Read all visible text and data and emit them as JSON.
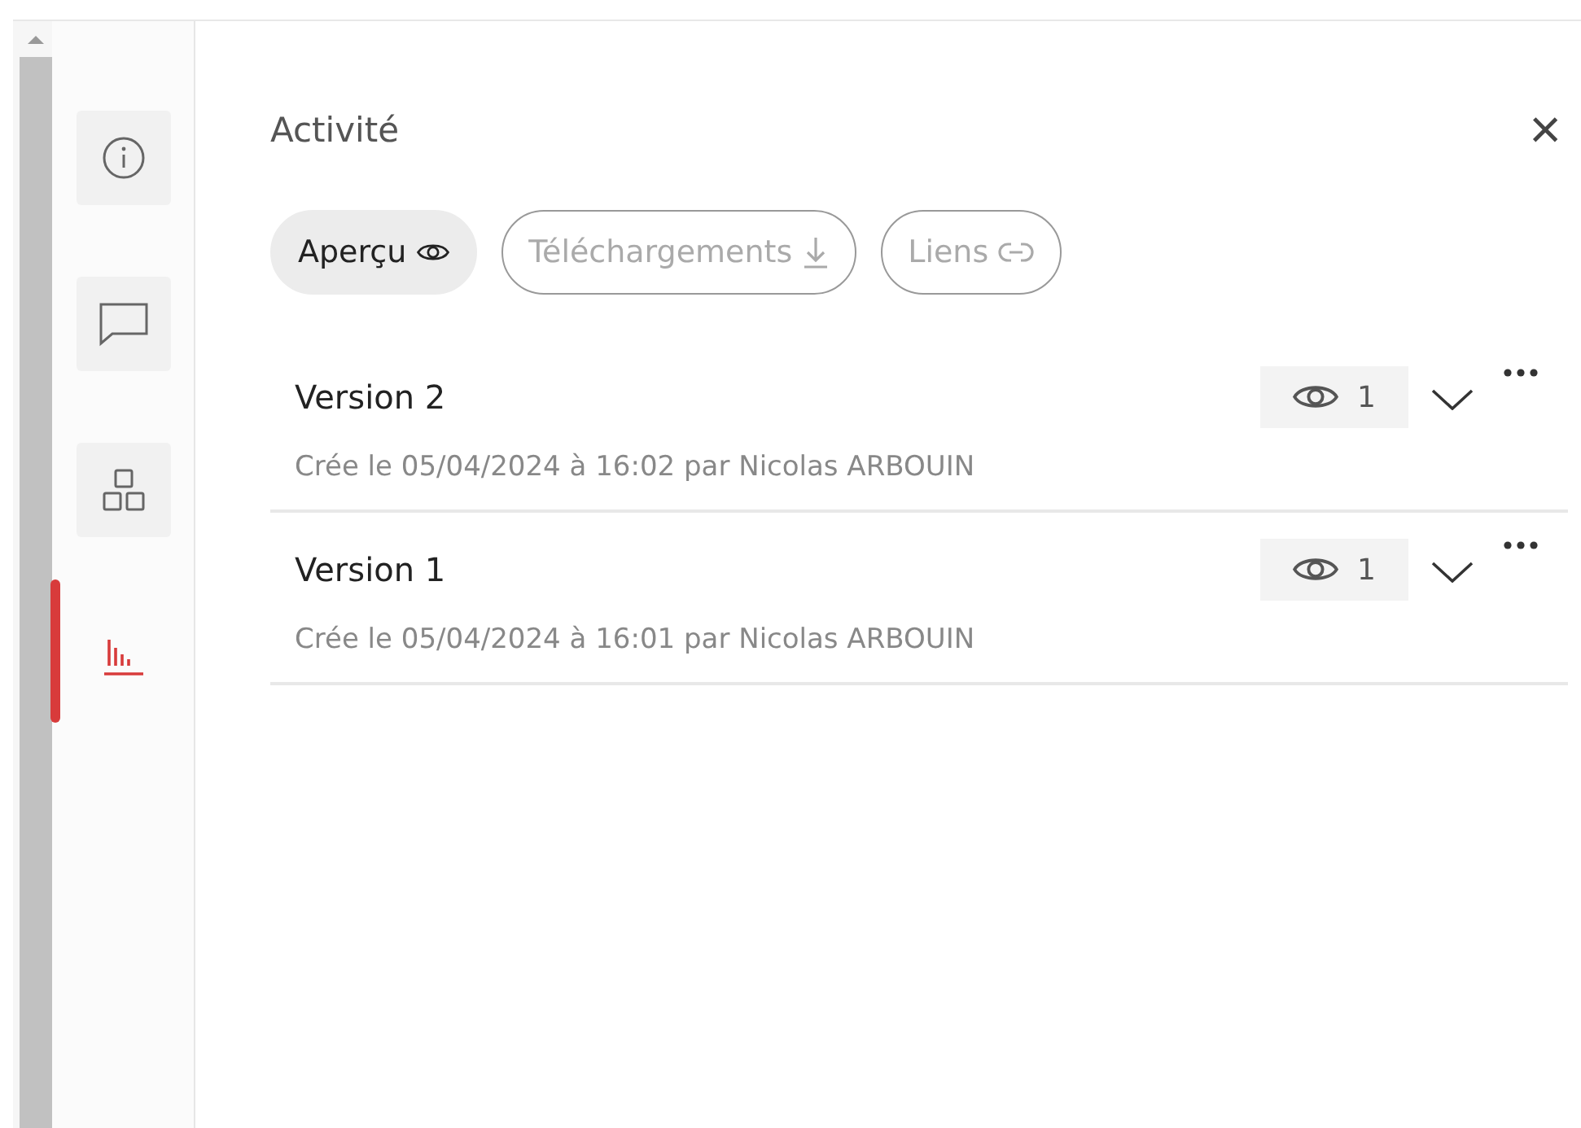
{
  "sidebar": {
    "items": [
      {
        "kind": "info",
        "selected": false
      },
      {
        "kind": "comment",
        "selected": false
      },
      {
        "kind": "apps",
        "selected": false
      },
      {
        "kind": "stats",
        "selected": true
      }
    ]
  },
  "panel": {
    "title": "Activité",
    "close_label": "×"
  },
  "filters": [
    {
      "label": "Aperçu",
      "kind": "view",
      "selected": true
    },
    {
      "label": "Téléchargements",
      "kind": "download",
      "selected": false
    },
    {
      "label": "Liens",
      "kind": "link",
      "selected": false
    }
  ],
  "versions": [
    {
      "name": "Version 2",
      "views": "1",
      "meta": "Crée le 05/04/2024 à 16:02 par Nicolas ARBOUIN"
    },
    {
      "name": "Version 1",
      "views": "1",
      "meta": "Crée le 05/04/2024 à 16:01 par Nicolas ARBOUIN"
    }
  ]
}
